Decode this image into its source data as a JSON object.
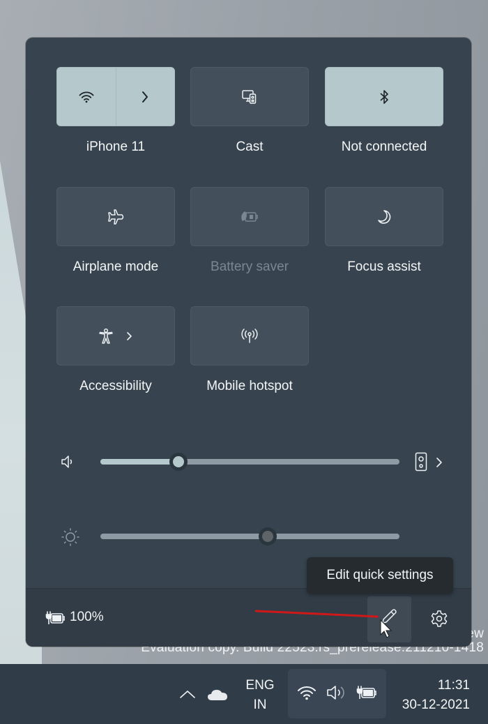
{
  "quick_settings": {
    "tiles": [
      {
        "label": "iPhone 11",
        "icon": "wifi-icon",
        "secondary_icon": "chevron-right-icon",
        "state": "on"
      },
      {
        "label": "Cast",
        "icon": "cast-icon",
        "state": "off"
      },
      {
        "label": "Not connected",
        "icon": "bluetooth-icon",
        "state": "on"
      },
      {
        "label": "Airplane mode",
        "icon": "airplane-icon",
        "state": "off"
      },
      {
        "label": "Battery saver",
        "icon": "battery-saver-icon",
        "state": "disabled"
      },
      {
        "label": "Focus assist",
        "icon": "moon-icon",
        "state": "off"
      },
      {
        "label": "Accessibility",
        "icon": "accessibility-icon",
        "secondary_icon": "chevron-right-icon",
        "state": "off"
      },
      {
        "label": "Mobile hotspot",
        "icon": "hotspot-icon",
        "state": "off"
      }
    ],
    "volume": {
      "icon": "speaker-icon",
      "value_percent": 26,
      "output_icon": "speaker-device-icon"
    },
    "brightness": {
      "icon": "brightness-icon",
      "value_percent": 56,
      "disabled": true
    },
    "footer": {
      "battery_icon": "battery-charging-icon",
      "battery_label": "100%",
      "edit_icon": "pencil-icon",
      "settings_icon": "gear-icon"
    },
    "tooltip": "Edit quick settings"
  },
  "watermark": {
    "line1": "ew",
    "line2": "Evaluation copy. Build 22523.rs_prerelease.211210-1418"
  },
  "taskbar": {
    "language": {
      "line1": "ENG",
      "line2": "IN"
    },
    "clock": {
      "time": "11:31",
      "date": "30-12-2021"
    },
    "tray_icons": [
      "chevron-up-icon",
      "onedrive-icon",
      "wifi-icon",
      "volume-icon",
      "battery-charging-icon"
    ]
  },
  "colors": {
    "panel_bg": "#37444f",
    "tile_on": "#b5c9cd",
    "tile_off": "#434f5a",
    "annotation_arrow": "#d01818"
  }
}
